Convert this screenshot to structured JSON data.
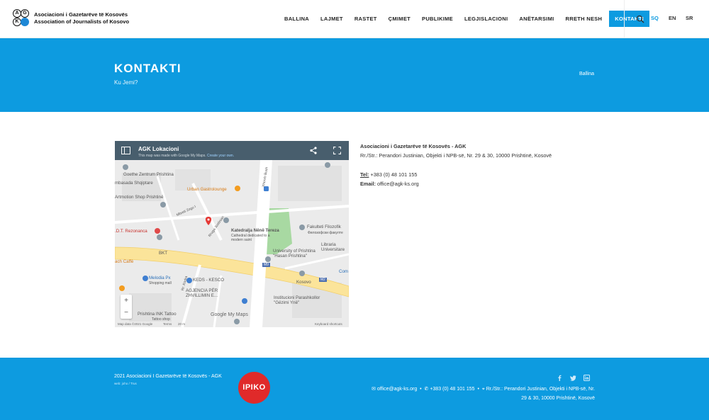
{
  "header": {
    "logo_line1": "Asociacioni i Gazetarëve të Kosovës",
    "logo_line2": "Association of Journalists of Kosovo",
    "logo_letters": [
      "A",
      "G",
      "K",
      ""
    ],
    "nav": [
      "BALLINA",
      "LAJMET",
      "RASTET",
      "ÇMIMET",
      "PUBLIKIME",
      "LEGJISLACIONI",
      "ANËTARSIMI",
      "RRETH NESH",
      "KONTAKTI"
    ],
    "active_nav": "KONTAKTI",
    "languages": [
      "SQ",
      "EN",
      "SR"
    ],
    "accent_color": "#0d9be0"
  },
  "hero": {
    "title": "KONTAKTI",
    "subtitle": "Ku Jemi?",
    "breadcrumb": "Ballina"
  },
  "map": {
    "title": "AGK Lokacioni",
    "subtitle_prefix": "This map was made with Google My Maps.",
    "subtitle_link": "Create your own.",
    "labels": {
      "goethe": "Goethe Zentrum Prishtina",
      "ambasada": "mbasada Shqiptare",
      "artmotion": "Artmotion Shop Prishtinë",
      "gastro": "Urban Gastrolounge",
      "rezonanca": ".D.T. Rezonanca",
      "katedralja": "Katedralja Nënë Tereza",
      "katedralja_sub": "Cathedral dedicated to a modern saint",
      "fakulteti": "Fakulteti Filozofik",
      "fakulteti_sub": "Филозофски факулте",
      "university": "University of Prishtina \"Hasan Prishtina\"",
      "libraria": "Libraria Universitare",
      "bkt": "BKT",
      "caffe": "ach Caffè",
      "melodia": "Melodia Px",
      "melodia_sub": "Shopping mall",
      "keds": "KEDS - KESCO",
      "agjencia": "AGJENCIA PËR ZHVILLIMIN E...",
      "institucioni": "Institucioni Parashkollor \"Gëzimi Ynë\"",
      "kosovo": "Kosovo",
      "ink": "Prishtina INK Tattoo",
      "ink_sub": "Tattoo shop",
      "xhorxh": "Xhorxh Bush",
      "mbreti": "Mbreti Zogu I",
      "rruga": "Rruga Justinian",
      "rr_kodra": "Rr. Kodra",
      "m9": "M9",
      "m2": "M2",
      "com": "Com"
    },
    "zoom_in": "+",
    "zoom_out": "−",
    "google": "Google My Maps",
    "map_data": "Map data ©2021 Google",
    "terms": "Terms",
    "scale": "20 m",
    "shortcuts": "Keyboard shortcuts"
  },
  "contact": {
    "org": "Asociacioni i Gazetarëve të Kosovës - AGK",
    "address": "Rr./Str.: Perandori Justinian, Objekti i NPB-së, Nr. 29 & 30, 10000 Prishtinë, Kosovë",
    "tel_label": "Tel:",
    "tel": "+383 (0) 48 101 155",
    "email_label": "Email:",
    "email": "office@agk-ks.org"
  },
  "footer": {
    "copyright": "2021 Asociacioni I Gazetarëve të Kosovës - AGK",
    "webby": "web: joho  /  Trus",
    "partner_logo": "IPIKO",
    "email": "office@agk-ks.org",
    "phone": "+383 (0) 48 101 155",
    "address_line1": "Rr./Str.: Perandori Justinian, Objekti i NPB-së, Nr.",
    "address_line2": "29 & 30, 10000 Prishtinë, Kosovë",
    "social": [
      "facebook-icon",
      "twitter-icon",
      "linkedin-icon"
    ]
  }
}
